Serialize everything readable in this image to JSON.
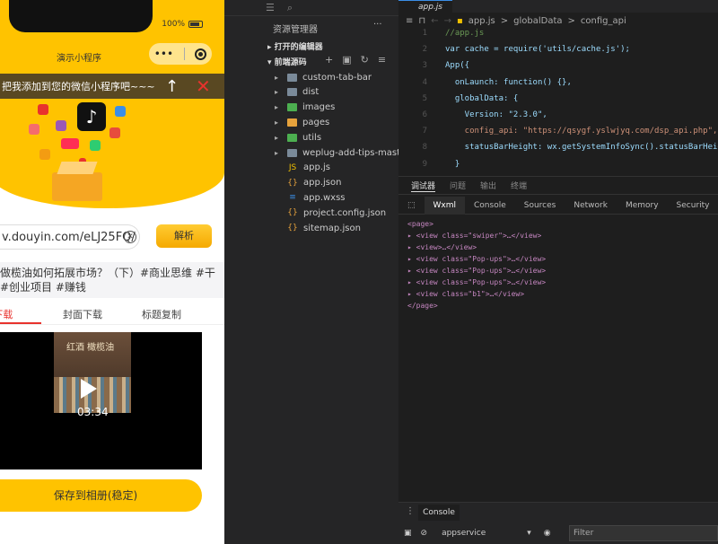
{
  "simulator": {
    "status_battery": "100%",
    "nav_title": "演示小程序",
    "capsule_more": "•••",
    "tip_text": "把我添加到您的微信小程序吧~~~",
    "tip_arrow": "↑",
    "tip_close": "✕",
    "url_value": "v.douyin.com/eLJ25FQ/",
    "clear_icon": "✕",
    "parse_label": "解析",
    "video_title": "做榄油如何拓展市场？（下）#商业思维 #干\n#创业项目 #赚钱",
    "tabs": [
      "视频下载",
      "封面下载",
      "标题复制"
    ],
    "tab_visible": [
      "]下载",
      "封面下载",
      "标题复制"
    ],
    "thumb_caption": "红酒  橄榄油",
    "duration": "03:34",
    "save_label": "保存到相册(稳定)"
  },
  "explorer": {
    "header": "资源管理器",
    "dots": "···",
    "open_editors": "打开的编辑器",
    "project": "前端源码",
    "items": [
      {
        "name": "custom-tab-bar",
        "type": "folder",
        "color": "#7a8a99"
      },
      {
        "name": "dist",
        "type": "folder",
        "color": "#7a8a99"
      },
      {
        "name": "images",
        "type": "folder",
        "color": "#4caf50"
      },
      {
        "name": "pages",
        "type": "folder",
        "color": "#e6a23c"
      },
      {
        "name": "utils",
        "type": "folder",
        "color": "#4caf50"
      },
      {
        "name": "weplug-add-tips-master",
        "type": "folder",
        "color": "#7a8a99"
      },
      {
        "name": "app.js",
        "type": "js",
        "glyph": "JS",
        "color": "#f0c000"
      },
      {
        "name": "app.json",
        "type": "json",
        "glyph": "{}",
        "color": "#e6a23c"
      },
      {
        "name": "app.wxss",
        "type": "css",
        "glyph": "≡",
        "color": "#3a8ee6"
      },
      {
        "name": "project.config.json",
        "type": "json",
        "glyph": "{}",
        "color": "#e6a23c"
      },
      {
        "name": "sitemap.json",
        "type": "json",
        "glyph": "{}",
        "color": "#e6a23c"
      }
    ]
  },
  "editor": {
    "tab": "app.js",
    "breadcrumb": [
      "app.js",
      ">",
      "globalData",
      ">",
      "config_api"
    ],
    "lines": [
      {
        "n": "1",
        "text": "//app.js"
      },
      {
        "n": "2",
        "text": "var cache = require('utils/cache.js');"
      },
      {
        "n": "3",
        "text": "App({"
      },
      {
        "n": "4",
        "text": "  onLaunch: function() {},"
      },
      {
        "n": "5",
        "text": "  globalData: {"
      },
      {
        "n": "6",
        "text": "    Version: \"2.3.0\","
      },
      {
        "n": "7",
        "text": "    config_api: \"https://qsygf.yslwjyq.com/dsp_api.php\","
      },
      {
        "n": "8",
        "text": "    statusBarHeight: wx.getSystemInfoSync().statusBarHeight"
      },
      {
        "n": "9",
        "text": "  }"
      }
    ]
  },
  "devtools": {
    "top_tabs": [
      "调试器",
      "问题",
      "输出",
      "终端"
    ],
    "panel_tabs": [
      "Wxml",
      "Console",
      "Sources",
      "Network",
      "Memory",
      "Security",
      "Mo"
    ],
    "dom": [
      "<page>",
      "▸ <view class=\"swiper\">…</view>",
      "▸ <view>…</view>",
      "▸ <view class=\"Pop-ups\">…</view>",
      "▸ <view class=\"Pop-ups\">…</view>",
      "▸ <view class=\"Pop-ups\">…</view>",
      "▸ <view class=\"b1\">…</view>",
      "</page>"
    ],
    "console_tab": "Console",
    "context": "appservice",
    "filter_placeholder": "Filter"
  }
}
